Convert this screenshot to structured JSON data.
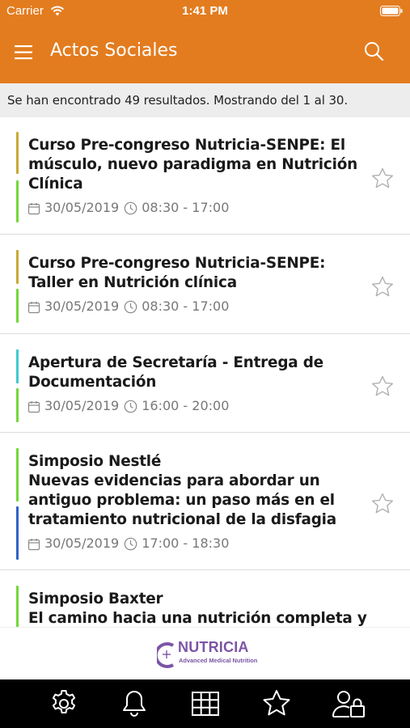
{
  "status_bar": {
    "carrier": "Carrier",
    "time": "1:41 PM",
    "icons": [
      "wifi-icon",
      "battery-icon"
    ]
  },
  "header": {
    "title": "Actos Sociales",
    "menu_icon": "hamburger-menu-icon",
    "search_icon": "search-icon"
  },
  "results": {
    "text": "Se han encontrado 49 resultados. Mostrando del 1 al 30."
  },
  "events": [
    {
      "title": "Curso Pre-congreso Nutricia-SENPE: El músculo, nuevo paradigma en Nutrición Clínica",
      "date": "30/05/2019",
      "time": "08:30 - 17:00",
      "colors": [
        "#c9a937",
        "#73d83a"
      ],
      "favorite": false
    },
    {
      "title": "Curso Pre-congreso Nutricia-SENPE: Taller en Nutrición clínica",
      "date": "30/05/2019",
      "time": "08:30 - 17:00",
      "colors": [
        "#c9a937",
        "#73d83a"
      ],
      "favorite": false
    },
    {
      "title": "Apertura de Secretaría - Entrega de Documentación",
      "date": "30/05/2019",
      "time": "16:00 - 20:00",
      "colors": [
        "#3fc9d0",
        "#73d83a"
      ],
      "favorite": false
    },
    {
      "title": "Simposio Nestlé\nNuevas evidencias para abordar un antiguo problema: un paso más en el tratamiento nutricional de la disfagia",
      "date": "30/05/2019",
      "time": "17:00 - 18:30",
      "colors": [
        "#73d83a",
        "#2f64c8"
      ],
      "favorite": false
    },
    {
      "title": "Simposio Baxter\nEl camino hacia una nutrición completa y",
      "date": "",
      "time": "",
      "colors": [
        "#73d83a"
      ],
      "favorite": false
    }
  ],
  "sponsor": {
    "name": "NUTRICIA",
    "tagline": "Advanced Medical Nutrition"
  },
  "tab_bar": {
    "tabs": [
      {
        "icon": "settings-gear-icon"
      },
      {
        "icon": "bell-icon"
      },
      {
        "icon": "grid-icon"
      },
      {
        "icon": "star-icon"
      },
      {
        "icon": "user-lock-icon"
      }
    ]
  },
  "colors": {
    "accent": "#e37c1f",
    "results_bg": "#ededed",
    "tab_bar": "#000000",
    "brand": "#7b55a5"
  }
}
